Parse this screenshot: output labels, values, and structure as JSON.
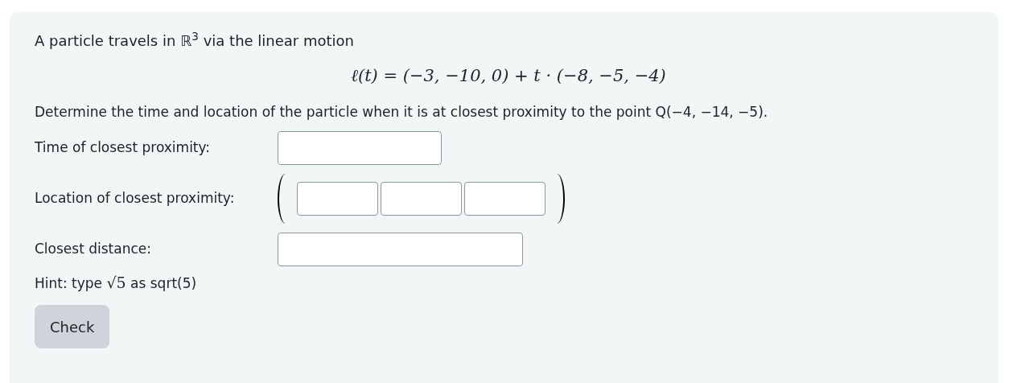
{
  "intro": "A particle travels in ℝ$^{3}$ via the linear motion",
  "equation": "ℓ(t) = (−3, −10, 0) + t · (−8, −5, −4)",
  "question": "Determine the time and location of the particle when it is at closest proximity to the point Q(−4, −14, −5).",
  "fields": [
    {
      "kind": "single",
      "label": "Time of closest proximity:"
    },
    {
      "kind": "vector",
      "label": "Location of closest proximity:"
    },
    {
      "kind": "wide",
      "label": "Closest distance:"
    }
  ],
  "hint": {
    "before": "Hint: type",
    "math": "√5",
    "after": "as sqrt(5)"
  },
  "button": "Check"
}
